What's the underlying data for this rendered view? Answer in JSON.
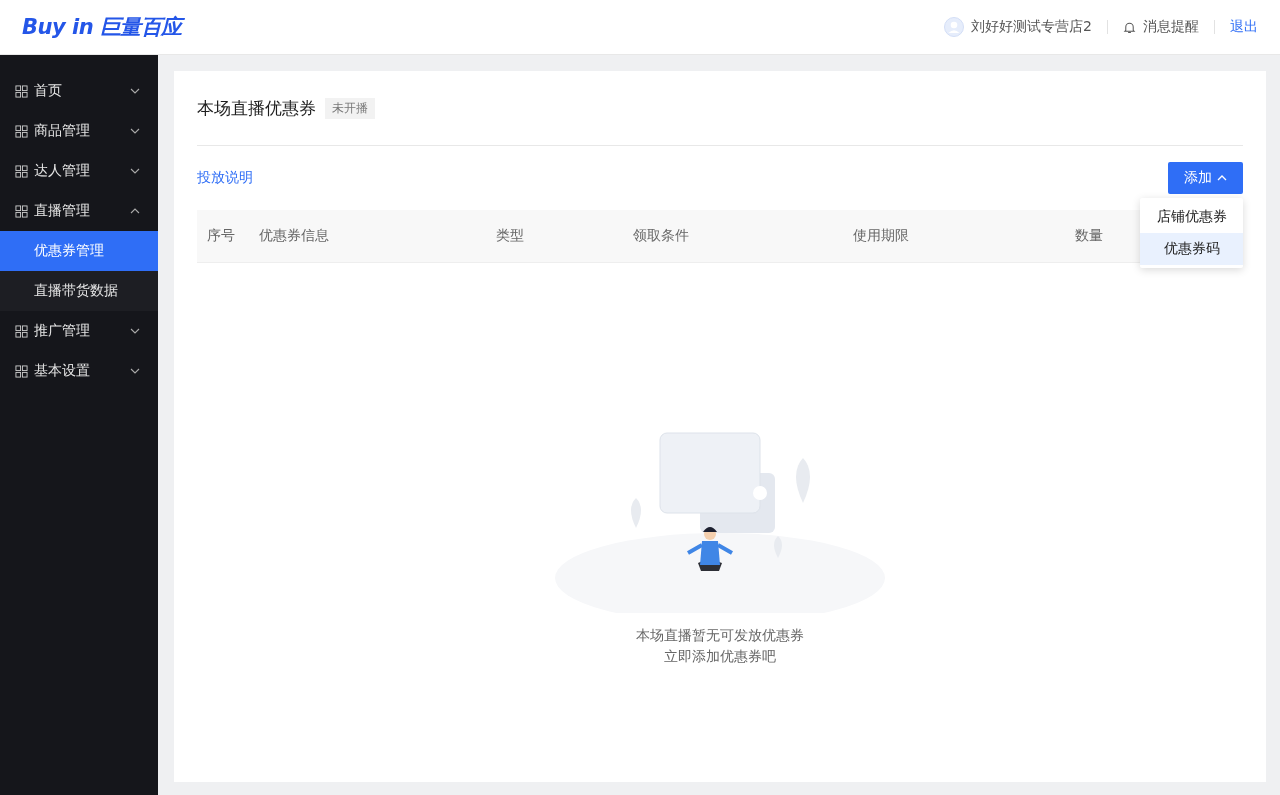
{
  "header": {
    "logo": "Buy in 巨量百应",
    "shop_name": "刘好好测试专营店2",
    "notifications": "消息提醒",
    "logout": "退出"
  },
  "sidebar": {
    "items": [
      {
        "label": "首页",
        "expanded": false
      },
      {
        "label": "商品管理",
        "expanded": false
      },
      {
        "label": "达人管理",
        "expanded": false
      },
      {
        "label": "直播管理",
        "expanded": true,
        "children": [
          {
            "label": "优惠券管理",
            "selected": true
          },
          {
            "label": "直播带货数据",
            "selected": false
          }
        ]
      },
      {
        "label": "推广管理",
        "expanded": false
      },
      {
        "label": "基本设置",
        "expanded": false
      }
    ]
  },
  "page": {
    "title": "本场直播优惠券",
    "status": "未开播",
    "help_link": "投放说明",
    "add_button": {
      "label": "添加",
      "expanded": true
    },
    "add_menu": [
      {
        "label": "店铺优惠券",
        "selected": false
      },
      {
        "label": "优惠券码",
        "selected": true
      }
    ],
    "table": {
      "columns": [
        "序号",
        "优惠券信息",
        "类型",
        "领取条件",
        "使用期限",
        "数量"
      ]
    },
    "empty_state": {
      "kind": "picture",
      "lines": [
        "本场直播暂无可发放优惠券",
        "立即添加优惠券吧"
      ]
    }
  }
}
